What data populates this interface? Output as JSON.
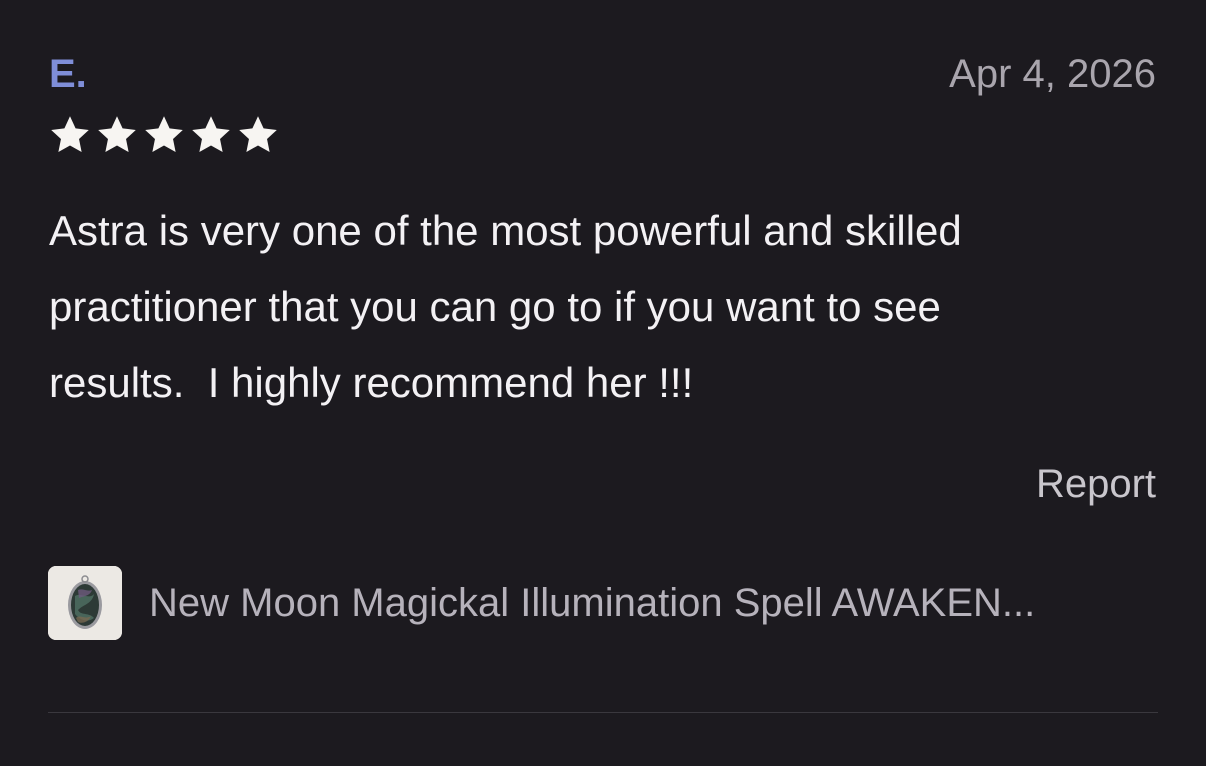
{
  "review": {
    "reviewer_name": "E.",
    "date": "Apr 4, 2026",
    "rating": 5,
    "rating_max": 5,
    "text": "Astra is very one of the most powerful and skilled\npractitioner that you can go to if you want to see\nresults.  I highly recommend her !!!",
    "report_label": "Report"
  },
  "listing": {
    "title": "New Moon Magickal Illumination Spell AWAKEN...",
    "thumbnail_icon": "oval-gemstone-pendant"
  },
  "colors": {
    "background": "#1c1a1f",
    "reviewer_name": "#7f8ed8",
    "star": "#f7f5f2",
    "body_text": "#f3f1f4",
    "muted_text": "#a9a5ad"
  }
}
